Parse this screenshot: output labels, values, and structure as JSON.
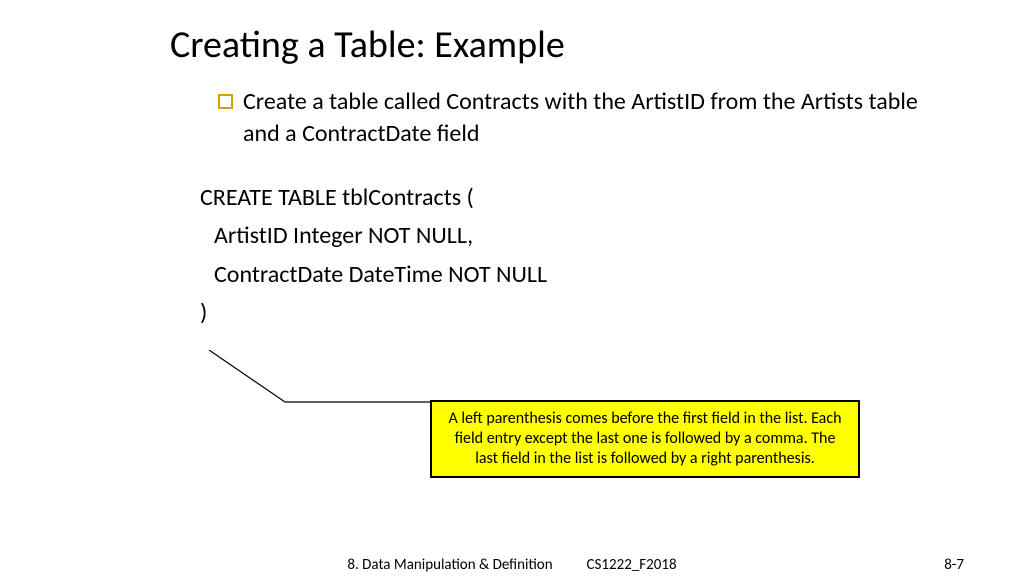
{
  "title": "Creating a Table: Example",
  "bullet": {
    "text": "Create a table called Contracts with the ArtistID from the Artists table and a ContractDate field"
  },
  "code": {
    "line1": "CREATE TABLE tblContracts (",
    "line2": "ArtistID Integer NOT NULL,",
    "line3": "ContractDate  DateTime NOT NULL",
    "line4": ")"
  },
  "callout": {
    "text": "A left parenthesis comes before the first field in the list. Each field entry except the last one is followed by a comma. The last field in the list is followed by a right parenthesis."
  },
  "footer": {
    "center_left": "8. Data Manipulation & Definition",
    "center_right": "CS1222_F2018",
    "page": "8-7"
  }
}
